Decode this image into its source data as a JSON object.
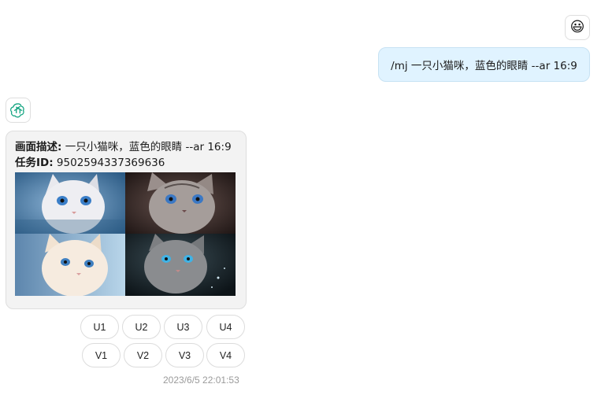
{
  "user_message": {
    "avatar_icon": "smiley-emoji-icon",
    "avatar_glyph": "😃",
    "text": "/mj 一只小猫咪，蓝色的眼睛 --ar 16:9"
  },
  "bot_message": {
    "avatar_icon": "openai-logo-icon",
    "description_label": "画面描述:",
    "description_value": " 一只小猫咪，蓝色的眼睛 --ar 16:9",
    "task_label": "任务ID:",
    "task_value": " 9502594337369636",
    "image_tiles": [
      {
        "name": "kitten-image-1",
        "bg": "#3c6f9a"
      },
      {
        "name": "kitten-image-2",
        "bg": "#3a2a26"
      },
      {
        "name": "kitten-image-3",
        "bg": "#a7c7e0"
      },
      {
        "name": "kitten-image-4",
        "bg": "#1a2a30"
      }
    ],
    "upscale_buttons": [
      "U1",
      "U2",
      "U3",
      "U4"
    ],
    "variation_buttons": [
      "V1",
      "V2",
      "V3",
      "V4"
    ],
    "timestamp": "2023/6/5 22:01:53"
  },
  "colors": {
    "user_bubble": "#e0f3ff",
    "bot_bubble": "#f3f3f3",
    "openai_green": "#10a37f"
  }
}
